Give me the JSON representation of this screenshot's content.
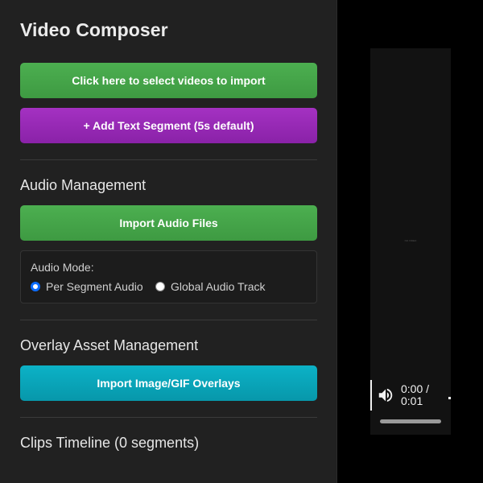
{
  "app": {
    "title": "Video Composer"
  },
  "import_videos": {
    "label": "Click here to select videos to import"
  },
  "add_text_segment": {
    "label": "+ Add Text Segment (5s default)"
  },
  "audio_management": {
    "title": "Audio Management",
    "import_label": "Import Audio Files",
    "mode_label": "Audio Mode:",
    "options": [
      {
        "label": "Per Segment Audio",
        "selected": true
      },
      {
        "label": "Global Audio Track",
        "selected": false
      }
    ]
  },
  "overlay_management": {
    "title": "Overlay Asset Management",
    "import_label": "Import Image/GIF Overlays"
  },
  "timeline": {
    "title": "Clips Timeline (0 segments)"
  },
  "preview": {
    "caption": "NO VIDEO",
    "time": "0:00 /\n0:01",
    "volume_icon": "volume-icon"
  },
  "colors": {
    "green": "#43a047",
    "purple": "#9c27b0",
    "cyan": "#00acc1",
    "radio_selected": "#0b6cff"
  }
}
